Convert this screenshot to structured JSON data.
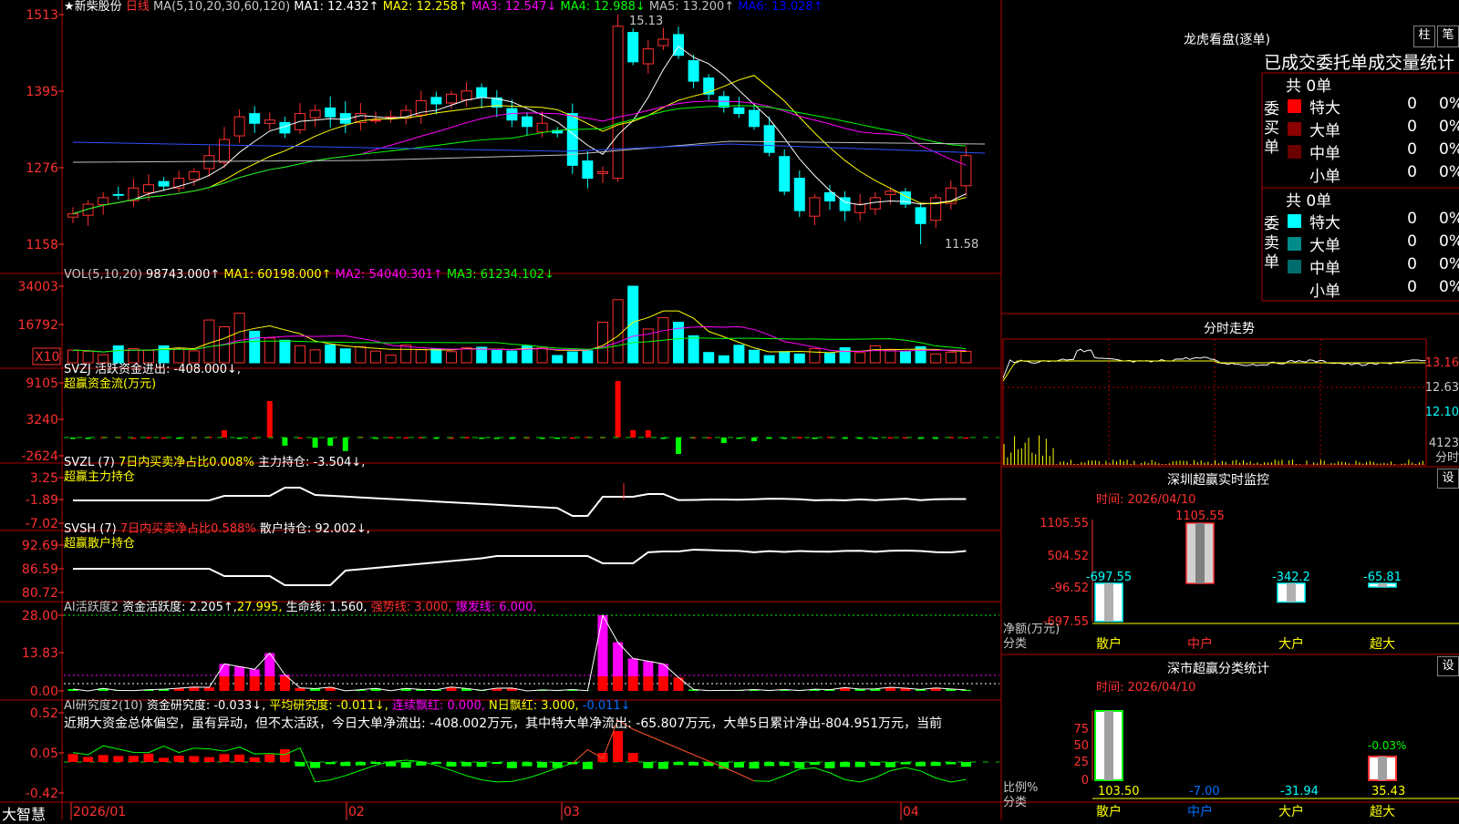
{
  "stock": {
    "star": "★",
    "name": "新柴股份",
    "period": "日线"
  },
  "ma_header": {
    "params": "MA(5,10,20,30,60,120)",
    "items": [
      {
        "text": "MA1: 12.432↑",
        "color": "#ffffff"
      },
      {
        "text": "MA2: 12.258↑",
        "color": "#ffff00"
      },
      {
        "text": "MA3: 12.547↓",
        "color": "#ff00ff"
      },
      {
        "text": "MA4: 12.988↓",
        "color": "#00ff00"
      },
      {
        "text": "MA5: 13.200↑",
        "color": "#c0c0c0"
      },
      {
        "text": "MA6: 13.028↑",
        "color": "#0000ff"
      }
    ]
  },
  "price_axis": [
    "1513",
    "1395",
    "1276",
    "1158"
  ],
  "price_marks": {
    "high": "15.13",
    "low": "11.58"
  },
  "vol_header": {
    "params": "VOL(5,10,20)",
    "value": "98743.000↑",
    "items": [
      {
        "text": "MA1: 60198.000↑",
        "color": "#ffff00"
      },
      {
        "text": "MA2: 54040.301↑",
        "color": "#ff00ff"
      },
      {
        "text": "MA3: 61234.102↓",
        "color": "#00ff00"
      }
    ]
  },
  "vol_axis": [
    "34003",
    "16792",
    "X10"
  ],
  "svzj": {
    "line1": "SVZJ  活跃资金进出: -408.000↓,",
    "line2": "超赢资金流(万元)",
    "axis": [
      "9105",
      "3240",
      "-2624"
    ]
  },
  "svzl": {
    "params": "SVZL (7)",
    "part1": "7日内买卖净占比0.008%",
    "part2": "主力持仓: -3.504↓,",
    "line2": "超赢主力持仓",
    "axis": [
      "3.25",
      "-1.89",
      "-7.02"
    ]
  },
  "svsh": {
    "params": "SVSH (7)",
    "part1": "7日内买卖净占比0.588%",
    "part2": "散户持仓: 92.002↓,",
    "line2": "超赢散户持仓",
    "axis": [
      "92.69",
      "86.59",
      "80.72"
    ]
  },
  "ai_active": {
    "title": "AI活跃度2",
    "part1": "资金活跃度: 2.205↑,",
    "part2": "27.995,",
    "part3": "生命线: 1.560,",
    "part4": "强势线: 3.000,",
    "part5": "爆发线: 6.000,",
    "axis": [
      "28.00",
      "13.83",
      "0.00"
    ]
  },
  "ai_research": {
    "title": "AI研究度2(10)",
    "part1": "资金研究度: -0.033↓,",
    "part2": "平均研究度: -0.011↓,",
    "part3": "连续飘红: 0.000,",
    "part4": "N日飘红: 3.000,",
    "part5": "-0.011↓",
    "comment": "近期大资金总体偏空，虽有异动，但不太活跃，今日大单净流出: -408.002万元，其中特大单净流出: -65.807万元，大单5日累计净出-804.951万元，当前",
    "axis": [
      "0.52",
      "0.05",
      "-0.42"
    ]
  },
  "dates": [
    "2026/01",
    "02",
    "03",
    "04"
  ],
  "logo": "大智慧",
  "right_panel": {
    "dragon_title": "龙虎看盘(逐单)",
    "btn_bar": "柱",
    "btn_pen": "笔",
    "stat_header": "已成交委托单成交量统计",
    "buy": {
      "side_label": "委买单",
      "total": "共 0单",
      "rows": [
        {
          "label": "特大",
          "qty": "0",
          "pct": "0%",
          "color": "#ff0000"
        },
        {
          "label": "大单",
          "qty": "0",
          "pct": "0%",
          "color": "#8b0000"
        },
        {
          "label": "中单",
          "qty": "0",
          "pct": "0%",
          "color": "#6b0000"
        },
        {
          "label": "小单",
          "qty": "0",
          "pct": "0%",
          "color": ""
        }
      ]
    },
    "sell": {
      "side_label": "委卖单",
      "total": "共 0单",
      "rows": [
        {
          "label": "特大",
          "qty": "0",
          "pct": "0%",
          "color": "#00ffff"
        },
        {
          "label": "大单",
          "qty": "0",
          "pct": "0%",
          "color": "#008b8b"
        },
        {
          "label": "中单",
          "qty": "0",
          "pct": "0%",
          "color": "#006b6b"
        },
        {
          "label": "小单",
          "qty": "0",
          "pct": "0%",
          "color": ""
        }
      ]
    },
    "intraday": {
      "title": "分时走势",
      "axis": [
        "13.16",
        "12.63",
        "12.10",
        "4123"
      ],
      "unit": "分时"
    },
    "sz_monitor": {
      "title": "深圳超赢实时监控",
      "btn": "设",
      "time": "时间: 2026/04/10",
      "axis": [
        "1105.55",
        "504.52",
        "-96.52",
        "-697.55"
      ],
      "ylabel": "净额(万元)",
      "xlabel": "分类",
      "cats": [
        "散户",
        "中户",
        "大户",
        "超大"
      ],
      "values": [
        -697.55,
        1105.55,
        -342.2,
        -65.81
      ],
      "value_labels": [
        "-697.55",
        "1105.55",
        "-342.2",
        "-65.81"
      ]
    },
    "sz_stats": {
      "title": "深市超赢分类统计",
      "btn": "设",
      "time": "时间: 2026/04/10",
      "axis": [
        "75",
        "50",
        "25",
        "0"
      ],
      "ylabel": "比例%",
      "xlabel": "分类",
      "cats": [
        "散户",
        "中户",
        "大户",
        "超大"
      ],
      "values": [
        103.5,
        -7.0,
        -31.94,
        35.43
      ],
      "value_labels": [
        "103.50",
        "-7.00",
        "-31.94",
        "35.43"
      ],
      "extra_label": "-0.03%"
    }
  }
}
